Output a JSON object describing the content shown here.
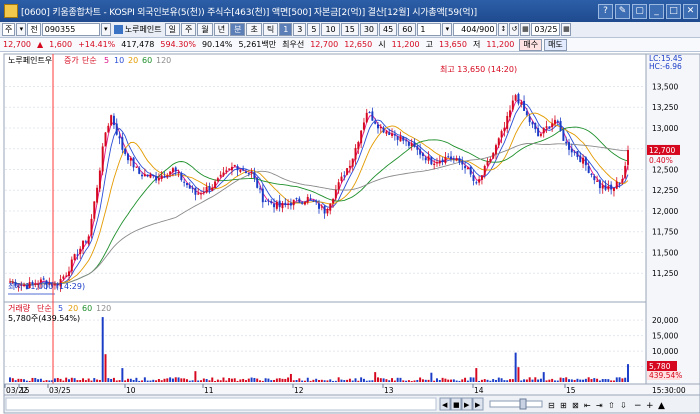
{
  "window": {
    "title": "[0600] 키움종합차트 - KOSPI 외국인보유(5(천)) 주식수[463(천)] 액면[500] 자본금[2(억)] 결산[12월] 시가총액[59(억)]",
    "controls": [
      "?",
      "✎",
      "▢",
      "_",
      "□",
      "✕"
    ]
  },
  "toolbar": {
    "market": "주",
    "all": "전",
    "code": "090355",
    "stock_name": "노루페인트",
    "period_buttons": [
      "일",
      "주",
      "월",
      "년",
      "분",
      "초",
      "틱"
    ],
    "active_period": "분",
    "minute_buttons": [
      "1",
      "3",
      "5",
      "10",
      "15",
      "30",
      "45",
      "60"
    ],
    "active_minute": "1",
    "interval_value": "1",
    "count": "404/900",
    "date": "03/25"
  },
  "quote": {
    "price": "12,700",
    "change_arrow": "▲",
    "change": "1,600",
    "change_pct": "+14.41%",
    "volume": "417,478",
    "volume_ratio": "594.30%",
    "turnover": "90.14%",
    "amount": "5,261백만",
    "best_ask_label": "최우선",
    "best_ask": "12,700",
    "best_bid": "12,650",
    "open_label": "시",
    "open": "11,200",
    "high_label": "고",
    "high": "13,650",
    "low_label": "저",
    "low": "11,200",
    "buy_label": "매수",
    "sell_label": "매도"
  },
  "price_panel": {
    "legend_name": "노루페인트우",
    "legend_type": "증가",
    "legend_ma_label": "단순",
    "ma_periods": [
      "5",
      "10",
      "20",
      "60",
      "120"
    ],
    "ma_colors": [
      "#e0148a",
      "#2b4ed6",
      "#e39b00",
      "#1d8f2a",
      "#8a8a8a"
    ],
    "lc_label": "LC:15.45",
    "hc_label": "HC:-6.96",
    "high_marker": "최고 13,650 (14:20)",
    "low_marker": "최저 11,000 (14:29)",
    "current_price_label": "12,700",
    "current_pct_label": "0.40%",
    "up_color": "#d6081f",
    "down_color": "#1a3cc7"
  },
  "volume_panel": {
    "legend_name": "거래량",
    "legend_ma_label": "단순",
    "ma_periods": [
      "5",
      "20",
      "60",
      "120"
    ],
    "value_label": "5,780주(439.54%)",
    "current_volume_label": "5,780",
    "current_pct_label": "439.54%"
  },
  "x_axis": {
    "labels": [
      "03/22",
      "15",
      "03/25",
      "10",
      "11",
      "12",
      "13",
      "14",
      "15"
    ],
    "time_label": "15:30:00"
  },
  "chart_data": [
    {
      "type": "candlestick",
      "title": "노루페인트우",
      "ylim": [
        11000,
        13650
      ],
      "y_ticks": [
        11250,
        11500,
        11750,
        12000,
        12250,
        12500,
        12750,
        13000,
        13250,
        13500
      ],
      "y_tick_labels": [
        "11,250",
        "11,500",
        "11,750",
        "12,000",
        "12,250",
        "12,500",
        "12,750",
        "13,000",
        "13,250",
        "13,500"
      ],
      "close_path": [
        [
          0,
          11150
        ],
        [
          6,
          11100
        ],
        [
          12,
          11160
        ],
        [
          16,
          11100
        ],
        [
          20,
          11250
        ],
        [
          24,
          11500
        ],
        [
          28,
          11700
        ],
        [
          31,
          12300
        ],
        [
          34,
          12950
        ],
        [
          36,
          13150
        ],
        [
          40,
          12750
        ],
        [
          46,
          12450
        ],
        [
          52,
          12400
        ],
        [
          58,
          12500
        ],
        [
          66,
          12200
        ],
        [
          72,
          12300
        ],
        [
          80,
          12550
        ],
        [
          86,
          12450
        ],
        [
          90,
          12150
        ],
        [
          96,
          12050
        ],
        [
          100,
          12100
        ],
        [
          106,
          12150
        ],
        [
          112,
          12000
        ],
        [
          116,
          12250
        ],
        [
          122,
          12650
        ],
        [
          127,
          13200
        ],
        [
          132,
          13000
        ],
        [
          138,
          12900
        ],
        [
          144,
          12750
        ],
        [
          150,
          12600
        ],
        [
          156,
          12650
        ],
        [
          162,
          12550
        ],
        [
          166,
          12300
        ],
        [
          172,
          12700
        ],
        [
          176,
          13000
        ],
        [
          180,
          13400
        ],
        [
          183,
          13200
        ],
        [
          188,
          12900
        ],
        [
          194,
          13100
        ],
        [
          198,
          12800
        ],
        [
          204,
          12600
        ],
        [
          210,
          12300
        ],
        [
          214,
          12250
        ],
        [
          218,
          12400
        ],
        [
          220,
          12700
        ]
      ],
      "x_range": [
        0,
        220
      ],
      "series": [
        {
          "name": "5",
          "smooth": 3
        },
        {
          "name": "10",
          "smooth": 6
        },
        {
          "name": "20",
          "smooth": 12
        },
        {
          "name": "60",
          "smooth": 30
        },
        {
          "name": "120",
          "smooth": 60
        }
      ]
    },
    {
      "type": "bar",
      "title": "거래량",
      "ylim": [
        0,
        22000
      ],
      "y_ticks": [
        5000,
        10000,
        15000,
        20000
      ],
      "y_tick_labels": [
        "5,000",
        "10,000",
        "15,000",
        "20,000"
      ],
      "spikes": [
        [
          33,
          21000
        ],
        [
          34,
          9000
        ],
        [
          40,
          4500
        ],
        [
          66,
          3500
        ],
        [
          100,
          2600
        ],
        [
          130,
          3200
        ],
        [
          150,
          3000
        ],
        [
          166,
          4500
        ],
        [
          180,
          9500
        ],
        [
          181,
          4800
        ],
        [
          190,
          3200
        ],
        [
          220,
          5780
        ]
      ],
      "baseline": 1100
    }
  ]
}
